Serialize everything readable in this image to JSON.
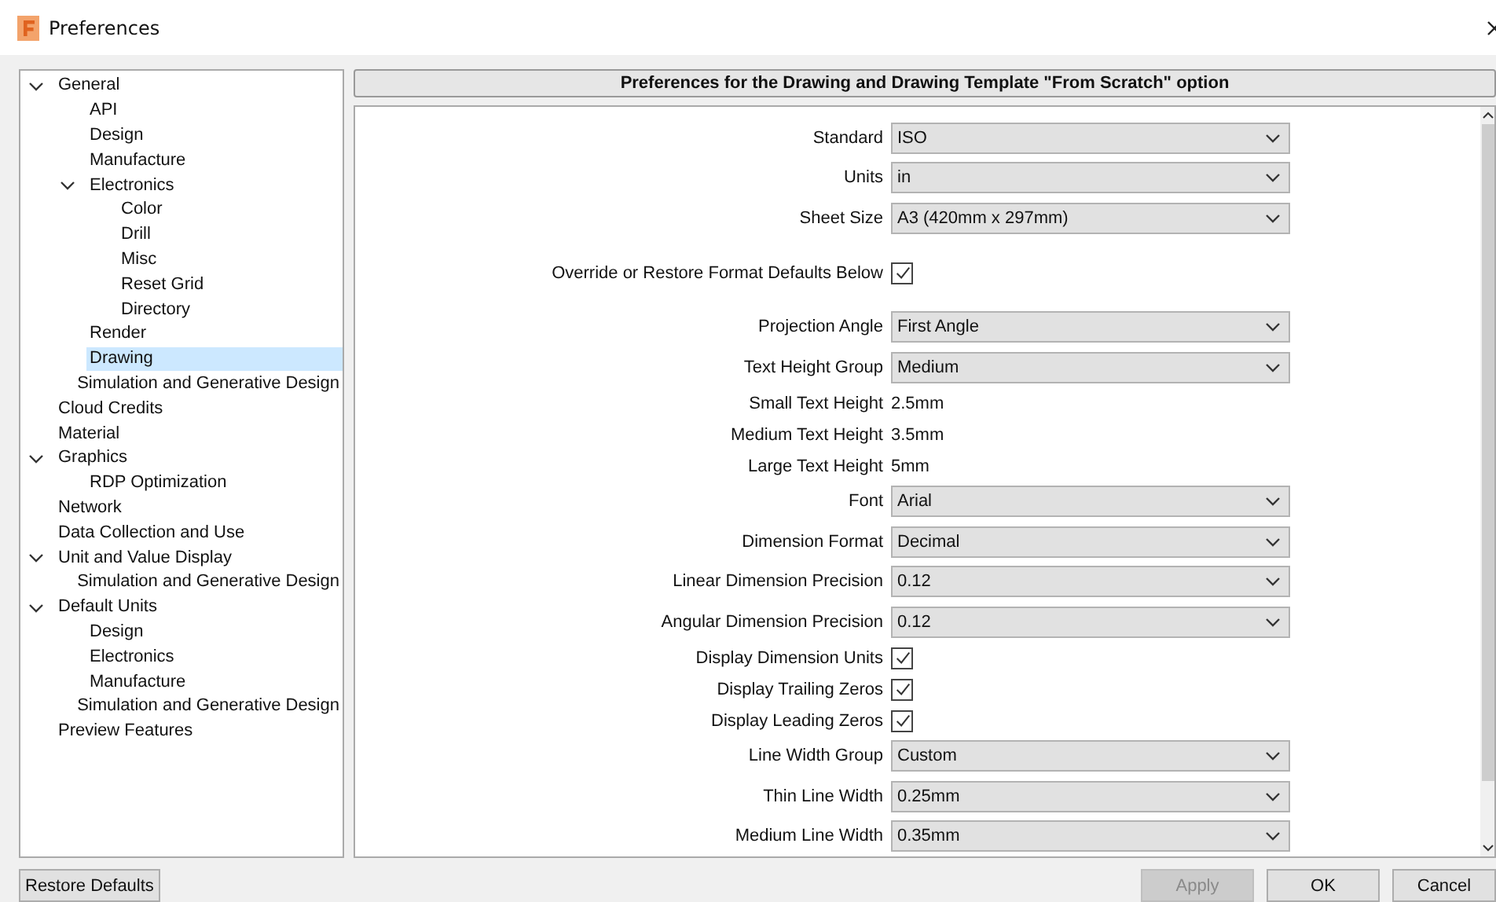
{
  "window": {
    "title": "Preferences"
  },
  "tree": [
    {
      "label": "General",
      "expanded": true,
      "selected": false,
      "children": [
        {
          "label": "API",
          "selected": false
        },
        {
          "label": "Design",
          "selected": false
        },
        {
          "label": "Manufacture",
          "selected": false
        },
        {
          "label": "Electronics",
          "expanded": true,
          "selected": false,
          "children": [
            {
              "label": "Color",
              "selected": false
            },
            {
              "label": "Drill",
              "selected": false
            },
            {
              "label": "Misc",
              "selected": false
            },
            {
              "label": "Reset Grid",
              "selected": false
            },
            {
              "label": "Directory",
              "selected": false
            }
          ]
        },
        {
          "label": "Render",
          "selected": false
        },
        {
          "label": "Drawing",
          "selected": true
        },
        {
          "label": "Simulation and Generative Design",
          "selected": false
        }
      ]
    },
    {
      "label": "Cloud Credits",
      "selected": false
    },
    {
      "label": "Material",
      "selected": false
    },
    {
      "label": "Graphics",
      "expanded": true,
      "selected": false,
      "children": [
        {
          "label": "RDP Optimization",
          "selected": false
        }
      ]
    },
    {
      "label": "Network",
      "selected": false
    },
    {
      "label": "Data Collection and Use",
      "selected": false
    },
    {
      "label": "Unit and Value Display",
      "expanded": true,
      "selected": false,
      "children": [
        {
          "label": "Simulation and Generative Design",
          "selected": false
        }
      ]
    },
    {
      "label": "Default Units",
      "expanded": true,
      "selected": false,
      "children": [
        {
          "label": "Design",
          "selected": false
        },
        {
          "label": "Electronics",
          "selected": false
        },
        {
          "label": "Manufacture",
          "selected": false
        },
        {
          "label": "Simulation and Generative Design",
          "selected": false
        }
      ]
    },
    {
      "label": "Preview Features",
      "selected": false
    }
  ],
  "panel": {
    "header": "Preferences for the Drawing and Drawing Template \"From Scratch\" option",
    "groups": [
      [
        {
          "kind": "dropdown",
          "label": "Standard",
          "value": "ISO"
        },
        {
          "kind": "dropdown",
          "label": "Units",
          "value": "in"
        },
        {
          "kind": "dropdown",
          "label": "Sheet Size",
          "value": "A3 (420mm x 297mm)"
        }
      ],
      [
        {
          "kind": "checkbox",
          "label": "Override or Restore Format Defaults Below",
          "checked": true
        }
      ],
      [
        {
          "kind": "dropdown",
          "label": "Projection Angle",
          "value": "First Angle"
        },
        {
          "kind": "dropdown",
          "label": "Text Height Group",
          "value": "Medium"
        },
        {
          "kind": "text",
          "label": "Small Text Height",
          "value": "2.5mm"
        },
        {
          "kind": "text",
          "label": "Medium Text Height",
          "value": "3.5mm"
        },
        {
          "kind": "text",
          "label": "Large Text Height",
          "value": "5mm"
        },
        {
          "kind": "dropdown",
          "label": "Font",
          "value": "Arial"
        },
        {
          "kind": "dropdown",
          "label": "Dimension Format",
          "value": "Decimal"
        },
        {
          "kind": "dropdown",
          "label": "Linear Dimension Precision",
          "value": "0.12"
        },
        {
          "kind": "dropdown",
          "label": "Angular Dimension Precision",
          "value": "0.12"
        },
        {
          "kind": "checkbox",
          "label": "Display Dimension Units",
          "checked": true
        },
        {
          "kind": "checkbox",
          "label": "Display Trailing Zeros",
          "checked": true
        },
        {
          "kind": "checkbox",
          "label": "Display Leading Zeros",
          "checked": true
        },
        {
          "kind": "dropdown",
          "label": "Line Width Group",
          "value": "Custom"
        },
        {
          "kind": "dropdown",
          "label": "Thin Line Width",
          "value": "0.25mm"
        },
        {
          "kind": "dropdown",
          "label": "Medium Line Width",
          "value": "0.35mm"
        }
      ]
    ]
  },
  "buttons": {
    "left": [
      {
        "label": "Restore Defaults",
        "disabled": false
      }
    ],
    "right": [
      {
        "label": "Apply",
        "disabled": true
      },
      {
        "label": "OK",
        "disabled": false
      },
      {
        "label": "Cancel",
        "disabled": false
      }
    ]
  }
}
